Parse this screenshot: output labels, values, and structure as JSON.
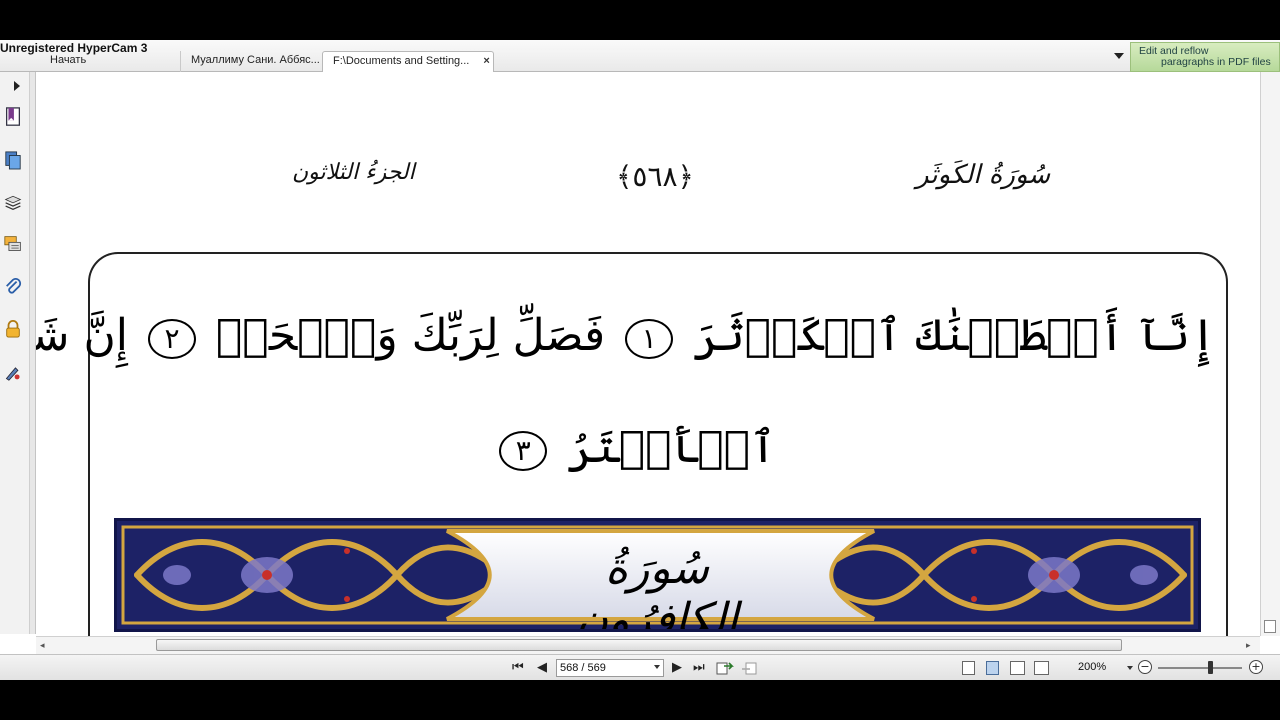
{
  "watermark": "Unregistered HyperCam 3",
  "tabs": [
    {
      "label": "Начать",
      "active": false
    },
    {
      "label": "Муаллиму Сани. Аббяс...",
      "active": false
    },
    {
      "label": "F:\\Documents and Setting...",
      "active": true,
      "close": "×"
    }
  ],
  "promo": {
    "line1": "Edit and reflow",
    "line2": "paragraphs in PDF files"
  },
  "sidebar_icons": [
    "bookmark-icon",
    "pages-icon",
    "layers-icon",
    "comments-icon",
    "attachment-icon",
    "security-lock-icon",
    "signature-icon"
  ],
  "page": {
    "surah_header": "سُورَةُ الكَوثَر",
    "page_number": "﴿٥٦٨﴾",
    "juz_header": "الجزءُ الثلاثون",
    "verse_line_1": {
      "a1": "إِنَّآ أَعۡطَيۡنَٰكَ ٱلۡكَوۡثَرَ",
      "n1": "١",
      "a2": "فَصَلِّ لِرَبِّكَ وَٱنۡحَرۡ",
      "n2": "٢",
      "a3": "إِنَّ شَانِئَكَ هُوَ"
    },
    "verse_line_2": {
      "a": "ٱلۡأَبۡتَرُ",
      "n": "٣"
    },
    "next_surah_title": "سُورَةُ الكافِرُون"
  },
  "toolbar": {
    "first_page": "⏮",
    "prev_page": "◀",
    "page_indicator": "568 / 569",
    "next_page": "▶",
    "last_page": "⏭",
    "zoom": "200%",
    "zoom_out": "−",
    "zoom_in": "+"
  },
  "colors": {
    "banner_bg": "#1d2266",
    "banner_gold": "#d4a640",
    "promo_bg": "#c6e3aa"
  }
}
